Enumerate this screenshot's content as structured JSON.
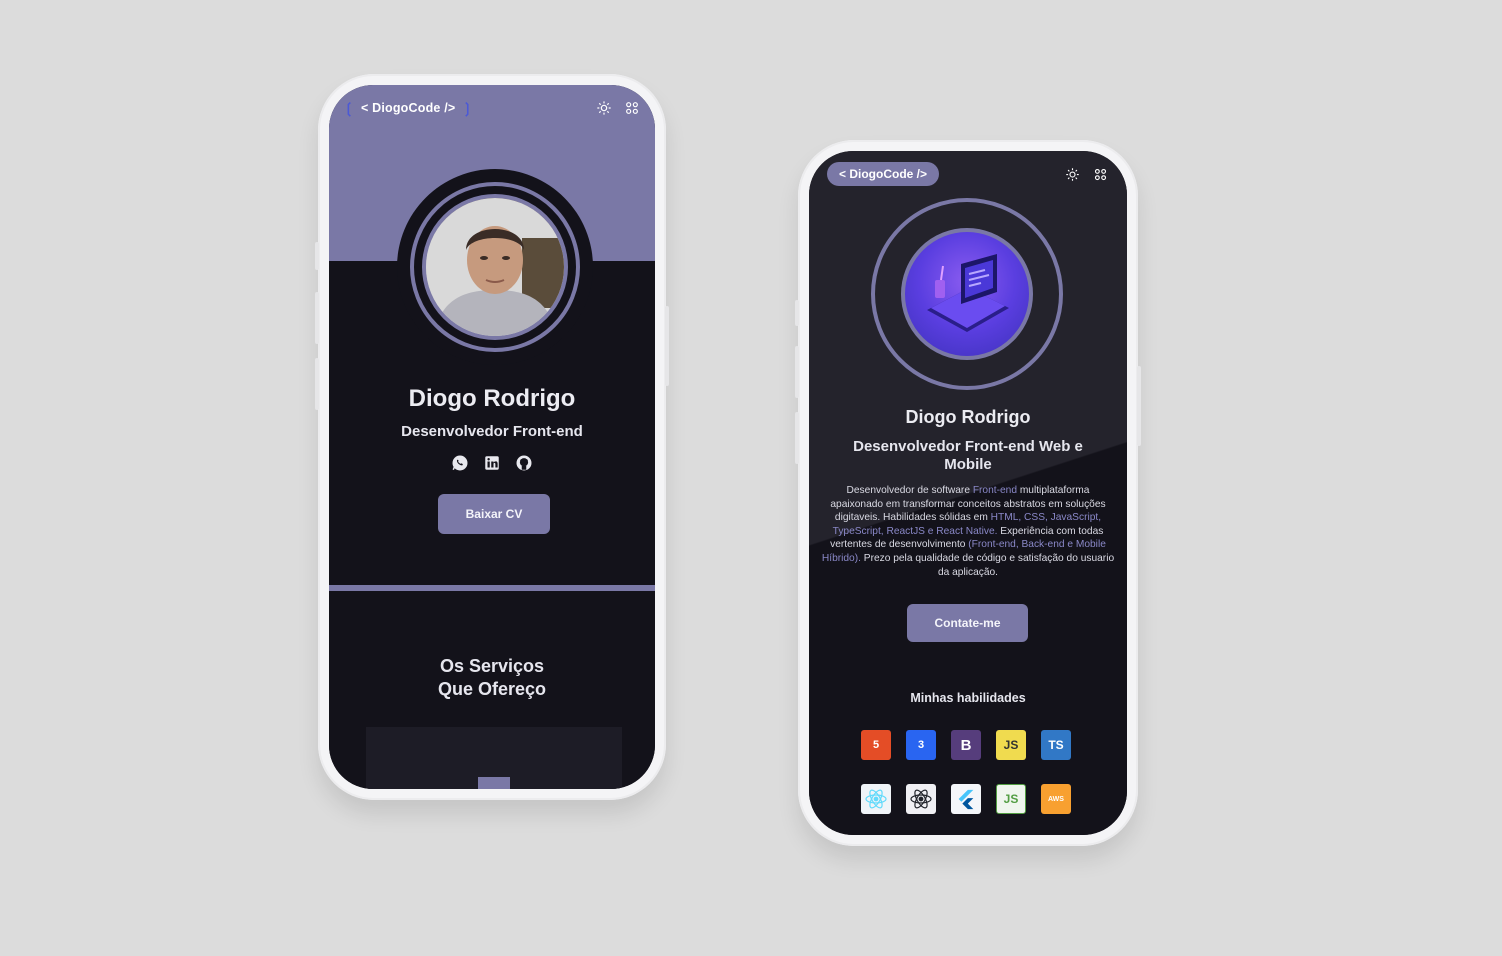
{
  "phone1": {
    "logo": "< DiogoCode />",
    "name": "Diogo Rodrigo",
    "role": "Desenvolvedor Front-end",
    "socials": [
      "whatsapp",
      "linkedin",
      "github"
    ],
    "cta": "Baixar CV",
    "section_title_line1": "Os Serviços",
    "section_title_line2": "Que Ofereço"
  },
  "phone2": {
    "logo": "< DiogoCode />",
    "name": "Diogo Rodrigo",
    "role_line1": "Desenvolvedor Front-end Web e",
    "role_line2": "Mobile",
    "bio": {
      "p1": "Desenvolvedor de software ",
      "h1": "Front-end",
      "p2": " multiplataforma apaixonado em transformar conceitos abstratos em soluções digitaveis. Habilidades sólidas em ",
      "h2": "HTML, CSS, JavaScript, TypeScript, ReactJS e React Native.",
      "p3": " Experiência com todas vertentes de desenvolvimento ",
      "h3": "(Front-end, Back-end e Mobile Híbrido).",
      "p4": " Prezo pela qualidade de código e satisfação do usuario da aplicação."
    },
    "cta": "Contate-me",
    "skills_title": "Minhas habilidades",
    "skills": [
      {
        "name": "html5-icon",
        "label": "5"
      },
      {
        "name": "css3-icon",
        "label": "3"
      },
      {
        "name": "bootstrap-icon",
        "label": "B"
      },
      {
        "name": "javascript-icon",
        "label": "JS"
      },
      {
        "name": "typescript-icon",
        "label": "TS"
      },
      {
        "name": "reactjs-icon",
        "label": ""
      },
      {
        "name": "react-native-icon",
        "label": ""
      },
      {
        "name": "flutter-icon",
        "label": ""
      },
      {
        "name": "nodejs-icon",
        "label": "JS"
      },
      {
        "name": "aws-icon",
        "label": "AWS"
      }
    ]
  },
  "colors": {
    "accent": "#7a78a6",
    "background": "#13121a",
    "highlight": "#8a88c8"
  }
}
